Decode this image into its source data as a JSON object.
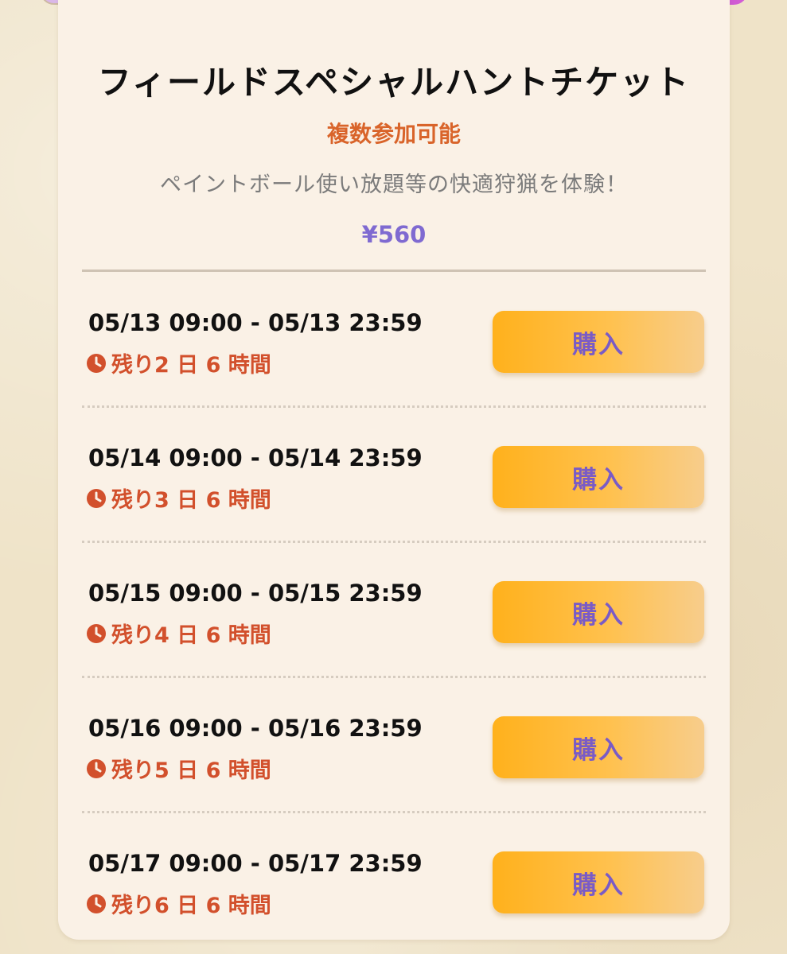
{
  "ticket": {
    "title": "フィールドスペシャルハントチケット",
    "subtitle": "複数参加可能",
    "description": "ペイントボール使い放題等の快適狩猟を体験！",
    "price": "¥560"
  },
  "colors": {
    "accent_orange": "#d9642a",
    "price_purple": "#7f6ad1",
    "button_gradient_start": "#ffb11c",
    "button_gradient_end": "#f7cd8c",
    "remaining_red": "#d2502c"
  },
  "icons": {
    "remaining": "clock-icon"
  },
  "slots": [
    {
      "date_range": "05/13 09:00 - 05/13 23:59",
      "remaining": "残り2 日 6 時間",
      "button_label": "購入"
    },
    {
      "date_range": "05/14 09:00 - 05/14 23:59",
      "remaining": "残り3 日 6 時間",
      "button_label": "購入"
    },
    {
      "date_range": "05/15 09:00 - 05/15 23:59",
      "remaining": "残り4 日 6 時間",
      "button_label": "購入"
    },
    {
      "date_range": "05/16 09:00 - 05/16 23:59",
      "remaining": "残り5 日 6 時間",
      "button_label": "購入"
    },
    {
      "date_range": "05/17 09:00 - 05/17 23:59",
      "remaining": "残り6 日 6 時間",
      "button_label": "購入"
    }
  ]
}
